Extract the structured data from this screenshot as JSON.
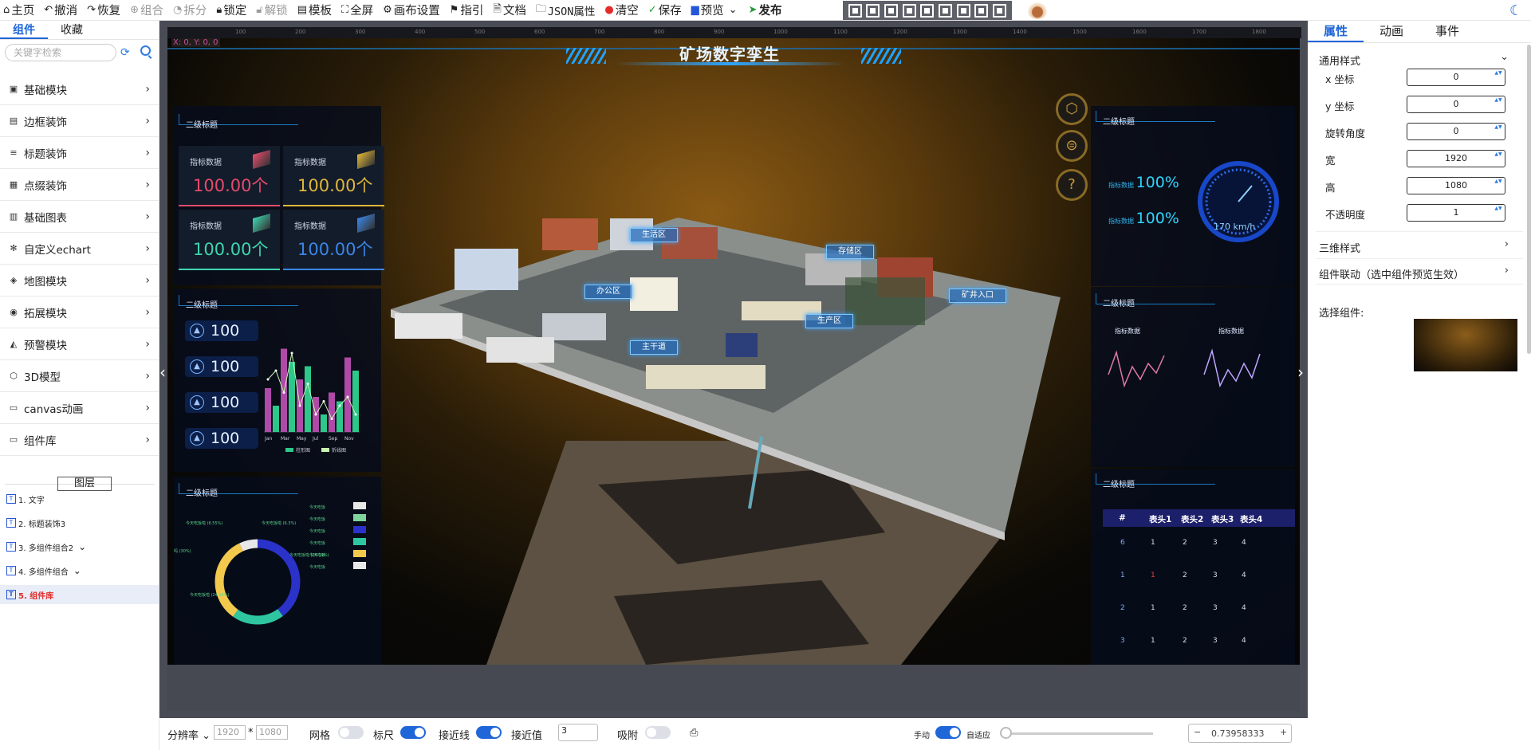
{
  "toolbar": {
    "home": "主页",
    "undo": "撤消",
    "redo": "恢复",
    "group": "组合",
    "split": "拆分",
    "lock": "锁定",
    "unlock": "解锁",
    "template": "模板",
    "fullscreen": "全屏",
    "canvas_settings": "画布设置",
    "guide": "指引",
    "docs": "文档",
    "json_props": "JSON属性",
    "clear": "清空",
    "save": "保存",
    "preview": "预览",
    "publish": "发布"
  },
  "left_panel": {
    "tabs": [
      "组件",
      "收藏"
    ],
    "search_placeholder": "关键字检索",
    "categories": [
      {
        "label": "基础模块",
        "icon": "box-icon"
      },
      {
        "label": "边框装饰",
        "icon": "frame-icon"
      },
      {
        "label": "标题装饰",
        "icon": "title-icon"
      },
      {
        "label": "点缀装饰",
        "icon": "dot-icon"
      },
      {
        "label": "基础图表",
        "icon": "bar-chart-icon"
      },
      {
        "label": "自定义echart",
        "icon": "custom-chart-icon"
      },
      {
        "label": "地图模块",
        "icon": "map-icon"
      },
      {
        "label": "拓展模块",
        "icon": "extend-icon"
      },
      {
        "label": "预警模块",
        "icon": "warning-icon"
      },
      {
        "label": "3D模型",
        "icon": "cube-icon"
      },
      {
        "label": "canvas动画",
        "icon": "canvas-icon"
      },
      {
        "label": "组件库",
        "icon": "library-icon"
      }
    ],
    "layers_title": "图层",
    "layers": [
      {
        "label": "1. 文字"
      },
      {
        "label": "2. 标题装饰3"
      },
      {
        "label": "3. 多组件组合2"
      },
      {
        "label": "4. 多组件组合"
      },
      {
        "label": "5. 组件库"
      }
    ]
  },
  "canvas": {
    "coord_readout": "X: 0, Y: 0, 0",
    "ruler_ticks": [
      "100",
      "200",
      "300",
      "400",
      "500",
      "600",
      "700",
      "800",
      "900",
      "1000",
      "1100",
      "1200",
      "1300",
      "1400",
      "1500",
      "1600",
      "1700",
      "1800"
    ]
  },
  "dashboard": {
    "title": "矿场数字孪生",
    "panel_title": "二级标题",
    "cards": [
      {
        "label": "指标数据",
        "value": "100.00个",
        "color": "#e64b6b"
      },
      {
        "label": "指标数据",
        "value": "100.00个",
        "color": "#e0b63a"
      },
      {
        "label": "指标数据",
        "value": "100.00个",
        "color": "#3fd5b0"
      },
      {
        "label": "指标数据",
        "value": "100.00个",
        "color": "#3a86e6"
      }
    ],
    "stats": [
      "100",
      "100",
      "100",
      "100"
    ],
    "bar_legend": [
      "柱形图",
      "折线图"
    ],
    "donut_labels": [
      "今天吃饭啦 (6.55%)",
      "今天吃饭啦 (6.3%)",
      "吗 (30%)",
      "今天吃饭啦 (24.14%)",
      "今天吃饭啦 (24.14%)"
    ],
    "donut_legend": [
      "今天吃饭",
      "今天吃饭",
      "今天吃饭",
      "今天吃饭",
      "今天吃饭",
      "今天吃饭"
    ],
    "right_stats": [
      {
        "label": "指标数据",
        "value": "100%"
      },
      {
        "label": "指标数据",
        "value": "100%"
      }
    ],
    "gauge_value": "170 km/h",
    "line_labels": [
      "指标数据",
      "指标数据"
    ],
    "table_headers": [
      "#",
      "表头1",
      "表头2",
      "表头3",
      "表头4"
    ],
    "table_rows": [
      [
        "6",
        "1",
        "2",
        "3",
        "4"
      ],
      [
        "1",
        "1",
        "2",
        "3",
        "4"
      ],
      [
        "2",
        "1",
        "2",
        "3",
        "4"
      ],
      [
        "3",
        "1",
        "2",
        "3",
        "4"
      ]
    ],
    "map_tags": [
      "生活区",
      "存储区",
      "办公区",
      "矿井入口",
      "生产区",
      "主干道"
    ]
  },
  "chart_data": {
    "type": "bar",
    "categories": [
      "Jan",
      "Mar",
      "May",
      "Jul",
      "Sep",
      "Nov"
    ],
    "series": [
      {
        "name": "柱形图",
        "values": [
          50,
          30,
          95,
          80,
          60,
          75,
          40,
          20,
          45,
          35,
          85,
          70
        ]
      },
      {
        "name": "折线图",
        "values": [
          60,
          70,
          45,
          90,
          30,
          55,
          20,
          35,
          15,
          30,
          40,
          20
        ]
      }
    ]
  },
  "right_panel": {
    "tabs": [
      "属性",
      "动画",
      "事件"
    ],
    "section_general": "通用样式",
    "props": [
      {
        "label": "x 坐标",
        "value": "0"
      },
      {
        "label": "y 坐标",
        "value": "0"
      },
      {
        "label": "旋转角度",
        "value": "0"
      },
      {
        "label": "宽",
        "value": "1920"
      },
      {
        "label": "高",
        "value": "1080"
      },
      {
        "label": "不透明度",
        "value": "1"
      }
    ],
    "section_3d": "三维样式",
    "section_link": "组件联动（选中组件预览生效）",
    "select_label": "选择组件:"
  },
  "status_bar": {
    "resolution_label": "分辨率",
    "width_placeholder": "1920",
    "height_placeholder": "1080",
    "grid_label": "网格",
    "ruler_label": "标尺",
    "snapline_label": "接近线",
    "snap_value_label": "接近值",
    "snap_value": "3",
    "adsorb_label": "吸附",
    "manual_label": "手动",
    "adaptive_label": "自适应",
    "zoom_value": "0.73958333",
    "grid_on": false,
    "ruler_on": true,
    "snapline_on": true,
    "adsorb_on": false,
    "adaptive_on": true
  }
}
